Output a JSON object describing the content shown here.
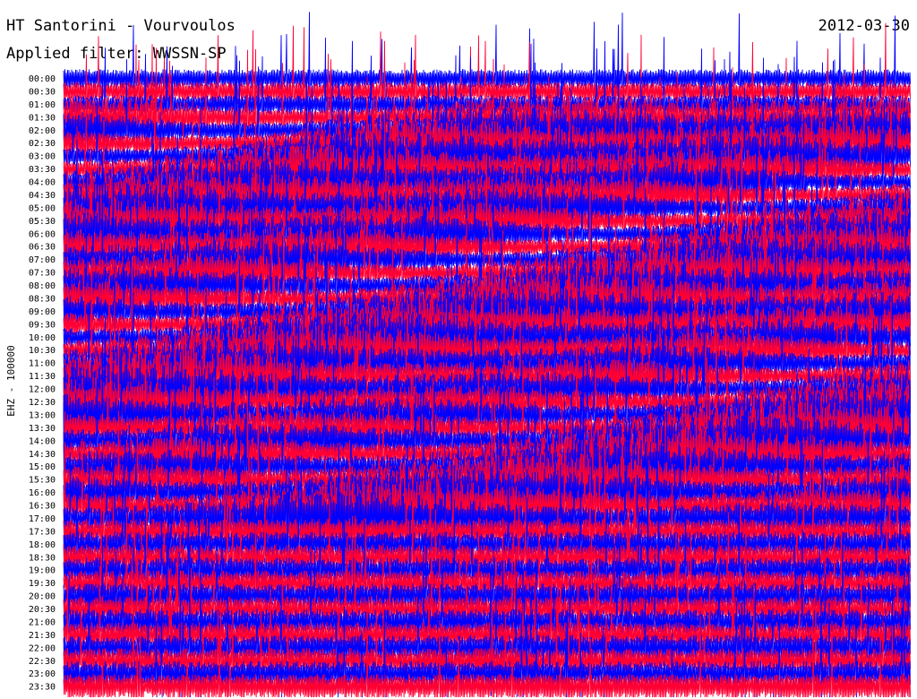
{
  "header": {
    "title": "HT Santorini - Vourvoulos",
    "date": "2012-03-30",
    "filter": "Applied filter: WWSSN-SP"
  },
  "chart_data": {
    "type": "line",
    "ylabel": "EHZ - 100000",
    "row_times": [
      "00:00",
      "00:30",
      "01:00",
      "01:30",
      "02:00",
      "02:30",
      "03:00",
      "03:30",
      "04:00",
      "04:30",
      "05:00",
      "05:30",
      "06:00",
      "06:30",
      "07:00",
      "07:30",
      "08:00",
      "08:30",
      "09:00",
      "09:30",
      "10:00",
      "10:30",
      "11:00",
      "11:30",
      "12:00",
      "12:30",
      "13:00",
      "13:30",
      "14:00",
      "14:30",
      "15:00",
      "15:30",
      "16:00",
      "16:30",
      "17:00",
      "17:30",
      "18:00",
      "18:30",
      "19:00",
      "19:30",
      "20:00",
      "20:30",
      "21:00",
      "21:30",
      "22:00",
      "22:30",
      "23:00",
      "23:30"
    ],
    "series_colors": [
      "#0000ff",
      "#ff0033"
    ],
    "legend": "none",
    "grid": false
  }
}
